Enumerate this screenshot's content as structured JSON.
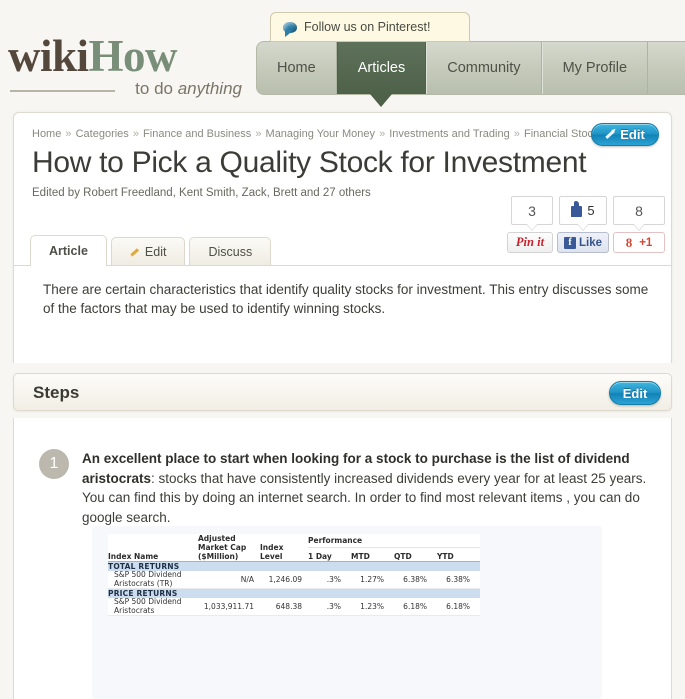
{
  "site": {
    "logo_wiki": "wiki",
    "logo_how": "How",
    "tagline_plain": "to do ",
    "tagline_italic": "anything"
  },
  "pinterest_tip": {
    "icon": "speech-bubble-icon",
    "label": "Follow us on Pinterest!"
  },
  "nav": {
    "items": [
      {
        "label": "Home",
        "active": false
      },
      {
        "label": "Articles",
        "active": true
      },
      {
        "label": "Community",
        "active": false
      },
      {
        "label": "My Profile",
        "active": false
      }
    ]
  },
  "breadcrumb": {
    "separator": "»",
    "items": [
      "Home",
      "Categories",
      "Finance and Business",
      "Managing Your Money",
      "Investments and Trading",
      "Financial Stocks"
    ]
  },
  "article": {
    "edit_button": "Edit",
    "title": "How to Pick a Quality Stock for Investment",
    "byline": "Edited by Robert Freedland, Kent Smith, Zack, Brett and 27 others",
    "intro": "There are certain characteristics that identify quality stocks for investment. This entry discusses some of the factors that may be used to identify winning stocks.",
    "tabs": [
      {
        "label": "Article",
        "selected": true,
        "icon": ""
      },
      {
        "label": "Edit",
        "selected": false,
        "icon": "pencil-icon"
      },
      {
        "label": "Discuss",
        "selected": false,
        "icon": ""
      }
    ]
  },
  "social": {
    "pin_count": "3",
    "fb_count": "5",
    "gplus_count": "8",
    "pin_label": "Pin it",
    "fb_label": "Like",
    "fb_glyph": "f",
    "gplus_number": "8",
    "gplus_label": "+1"
  },
  "steps_section": {
    "title": "Steps",
    "edit_button": "Edit"
  },
  "steps": [
    {
      "number": "1",
      "bold_lead": "An excellent place to start when looking for a stock to purchase is the list of dividend aristocrats",
      "rest": ": stocks that have consistently increased dividends every year for at least 25 years. You can find this by doing an internet search. In order to find most relevant items , you can do google search."
    }
  ],
  "index_table": {
    "col_index_name": "Index Name",
    "col_adjusted_market_cap": "Adjusted Market Cap ($Million)",
    "col_index_level": "Index Level",
    "col_performance": "Performance",
    "perf_cols": [
      "1 Day",
      "MTD",
      "QTD",
      "YTD"
    ],
    "sections": [
      {
        "heading": "TOTAL RETURNS",
        "rows": [
          {
            "name": "S&P 500 Dividend Aristocrats (TR)",
            "adjusted_market_cap": "N/A",
            "index_level": "1,246.09",
            "one_day": ".3%",
            "mtd": "1.27%",
            "qtd": "6.38%",
            "ytd": "6.38%"
          }
        ]
      },
      {
        "heading": "PRICE RETURNS",
        "rows": [
          {
            "name": "S&P 500 Dividend Aristocrats",
            "adjusted_market_cap": "1,033,911.71",
            "index_level": "648.38",
            "one_day": ".3%",
            "mtd": "1.23%",
            "qtd": "6.18%",
            "ytd": "6.18%"
          }
        ]
      }
    ]
  },
  "colors": {
    "nav_active": "#4e6149",
    "logo_green": "#798e78",
    "logo_brown": "#54483c",
    "edit_blue": "#1f93c6",
    "table_section_blue": "#ccddef",
    "pin_red": "#c8232c",
    "fb_blue": "#3b5998",
    "gplus_red": "#d14836"
  }
}
